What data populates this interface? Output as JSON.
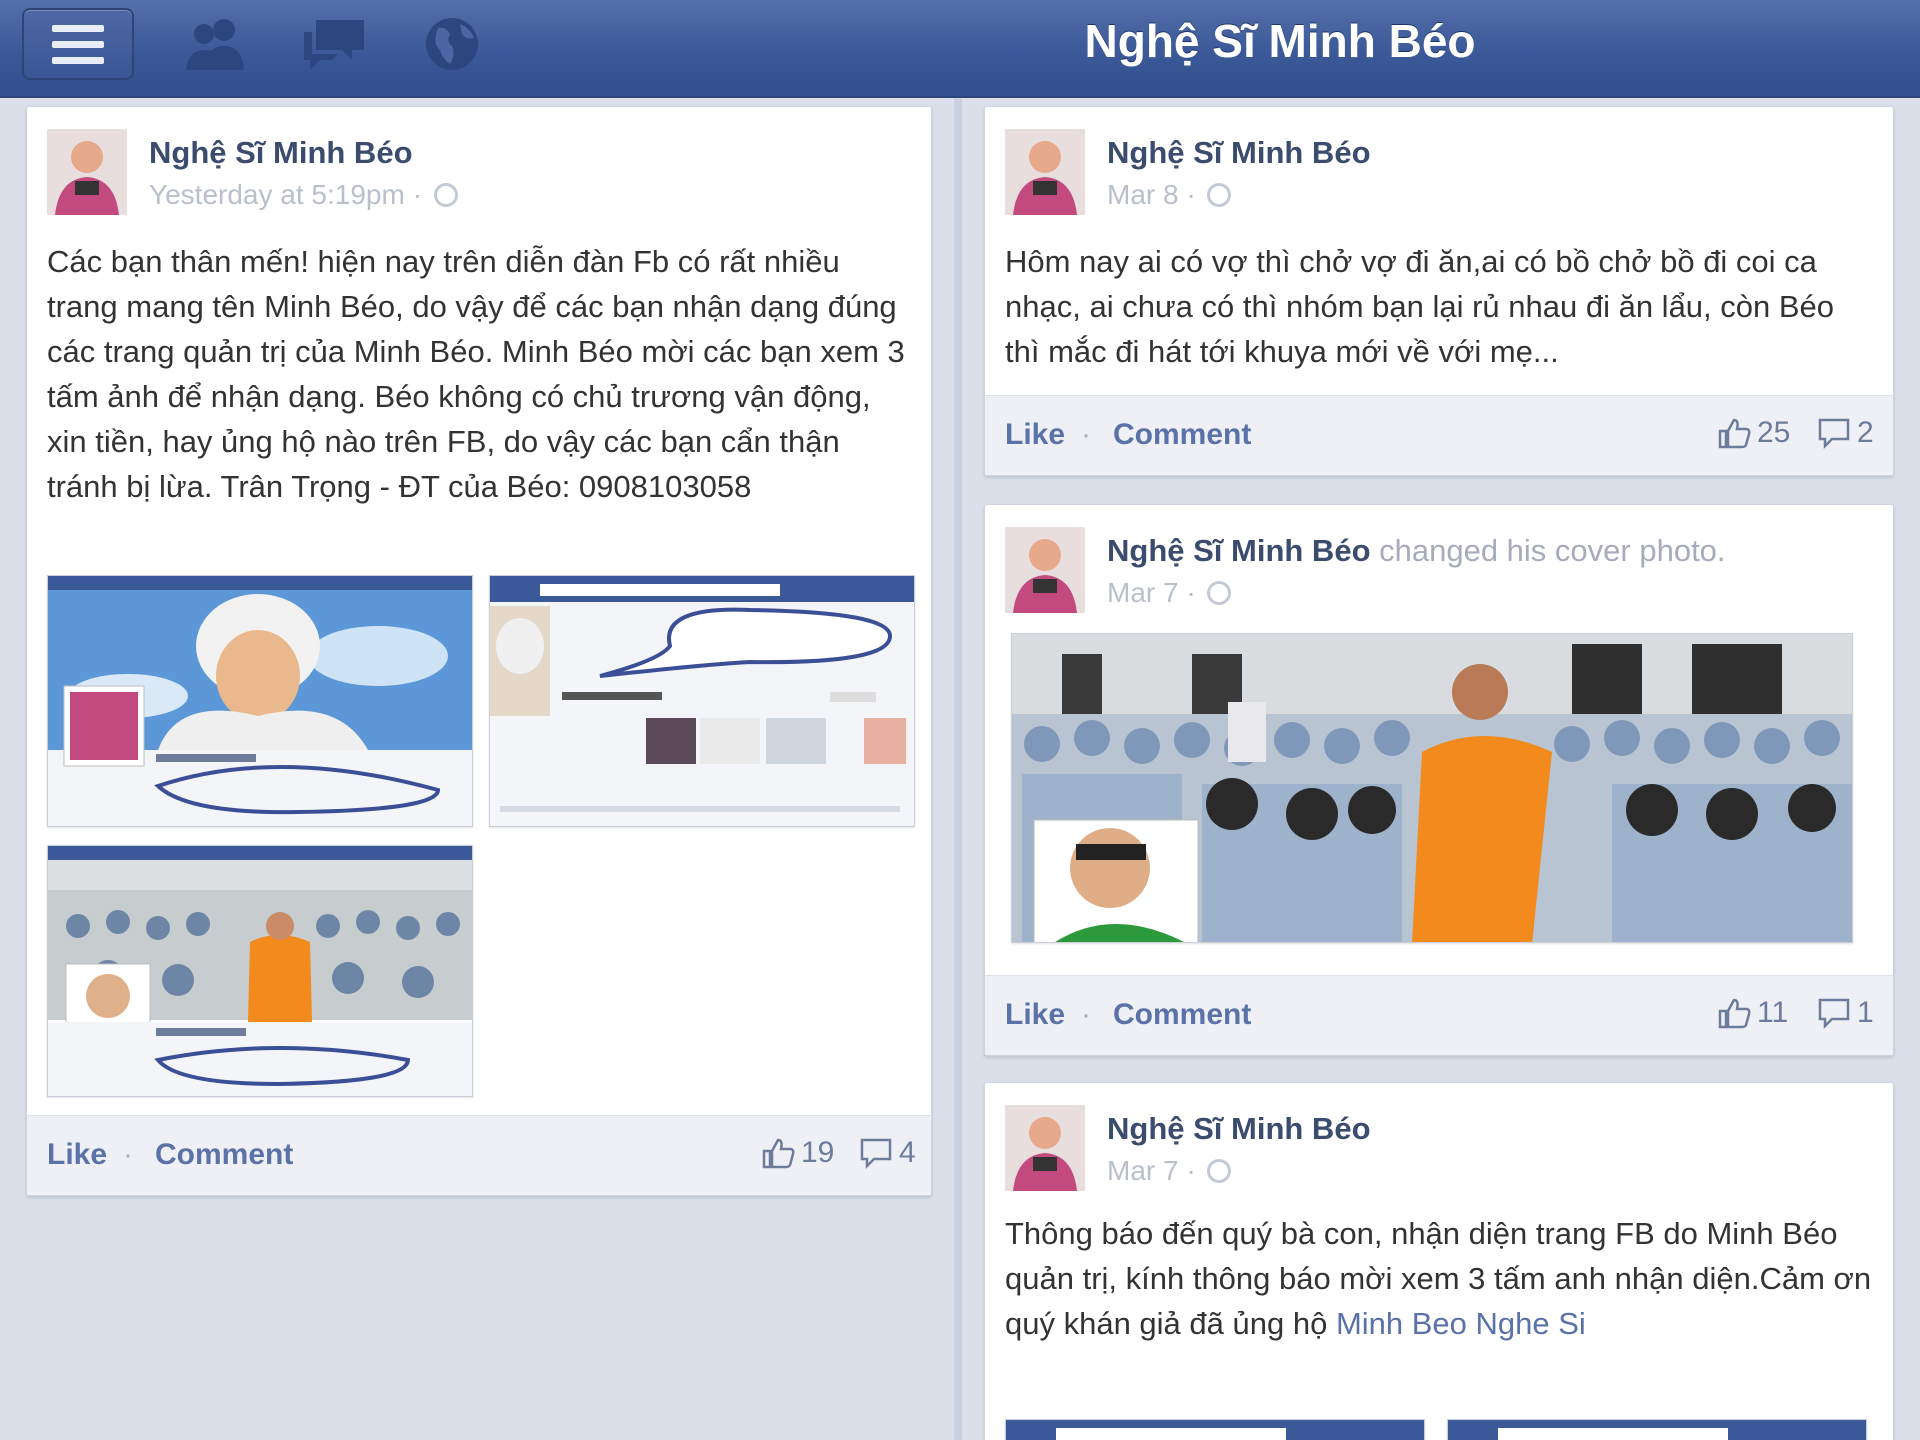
{
  "header": {
    "title": "Nghệ Sĩ Minh Béo"
  },
  "icons": [
    "menu-icon",
    "friends-icon",
    "messages-icon",
    "notifications-globe-icon"
  ],
  "colors": {
    "brand": "#3b5998",
    "link": "#5b72a8",
    "background": "#dadfea"
  },
  "posts": [
    {
      "author": "Nghệ Sĩ Minh Béo",
      "time": "Yesterday at 5:19pm ·",
      "text": "Các bạn thân mến! hiện nay trên diễn đàn Fb có rất nhiều trang mang tên Minh Béo, do vậy để các bạn nhận dạng đúng các trang quản trị của Minh Béo. Minh Béo mời các bạn xem 3 tấm ảnh để nhận dạng. Béo không có chủ trương vận động, xin tiền, hay ủng hộ nào trên FB, do vậy các bạn cẩn thận tránh bị lừa. Trân Trọng - ĐT của Béo: 0908103058",
      "like_label": "Like",
      "separator": "·",
      "comment_label": "Comment",
      "likes": "19",
      "comments": "4"
    },
    {
      "author": "Nghệ Sĩ Minh Béo",
      "time": "Mar 8 ·",
      "text": "Hôm nay ai có vợ thì chở vợ đi ăn,ai có bồ chở bồ đi coi ca nhạc, ai chưa có thì nhóm bạn lại rủ nhau đi ăn lẩu, còn Béo thì mắc đi hát tới khuya mới về với mẹ...",
      "like_label": "Like",
      "separator": "·",
      "comment_label": "Comment",
      "likes": "25",
      "comments": "2"
    },
    {
      "author": "Nghệ Sĩ Minh Béo",
      "action": "changed his cover photo.",
      "time": "Mar 7 ·",
      "like_label": "Like",
      "separator": "·",
      "comment_label": "Comment",
      "likes": "11",
      "comments": "1"
    },
    {
      "author": "Nghệ Sĩ Minh Béo",
      "time": "Mar 7 ·",
      "text": "Thông báo đến quý bà con, nhận diện trang FB do Minh Béo quản trị, kính thông báo mời xem 3 tấm anh nhận diện.Cảm ơn quý khán giả đã ủng hộ ",
      "link": "Minh Beo Nghe Si"
    }
  ]
}
